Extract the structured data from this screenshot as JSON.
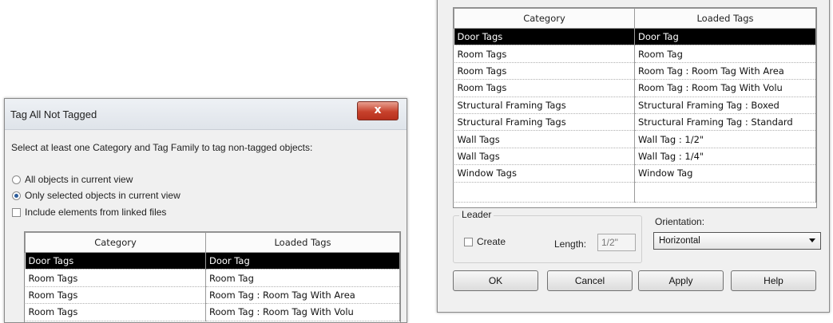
{
  "left_dialog": {
    "title": "Tag All Not Tagged",
    "close_label": "x",
    "instruction": "Select at least one Category and Tag Family to tag non-tagged objects:",
    "radio_all": "All objects in current view",
    "radio_selected": "Only selected objects in current view",
    "include_linked": "Include elements from linked files",
    "table": {
      "headers": [
        "Category",
        "Loaded Tags"
      ],
      "rows": [
        [
          "Door Tags",
          "Door Tag"
        ],
        [
          "Room Tags",
          "Room Tag"
        ],
        [
          "Room Tags",
          "Room Tag : Room Tag With Area"
        ],
        [
          "Room Tags",
          "Room Tag : Room Tag With Volu"
        ]
      ]
    }
  },
  "right_dialog": {
    "table": {
      "headers": [
        "Category",
        "Loaded Tags"
      ],
      "rows": [
        [
          "Door Tags",
          "Door Tag"
        ],
        [
          "Room Tags",
          "Room Tag"
        ],
        [
          "Room Tags",
          "Room Tag : Room Tag With Area"
        ],
        [
          "Room Tags",
          "Room Tag : Room Tag With Volu"
        ],
        [
          "Structural Framing Tags",
          "Structural Framing Tag : Boxed"
        ],
        [
          "Structural Framing Tags",
          "Structural Framing Tag : Standard"
        ],
        [
          "Wall Tags",
          "Wall Tag : 1/2\""
        ],
        [
          "Wall Tags",
          "Wall Tag : 1/4\""
        ],
        [
          "Window Tags",
          "Window Tag"
        ],
        [
          "",
          ""
        ]
      ]
    },
    "leader_label": "Leader",
    "create_label": "Create",
    "length_label": "Length:",
    "length_value": "1/2\"",
    "orientation_label": "Orientation:",
    "orientation_value": "Horizontal",
    "buttons": {
      "ok": "OK",
      "cancel": "Cancel",
      "apply": "Apply",
      "help": "Help"
    }
  }
}
